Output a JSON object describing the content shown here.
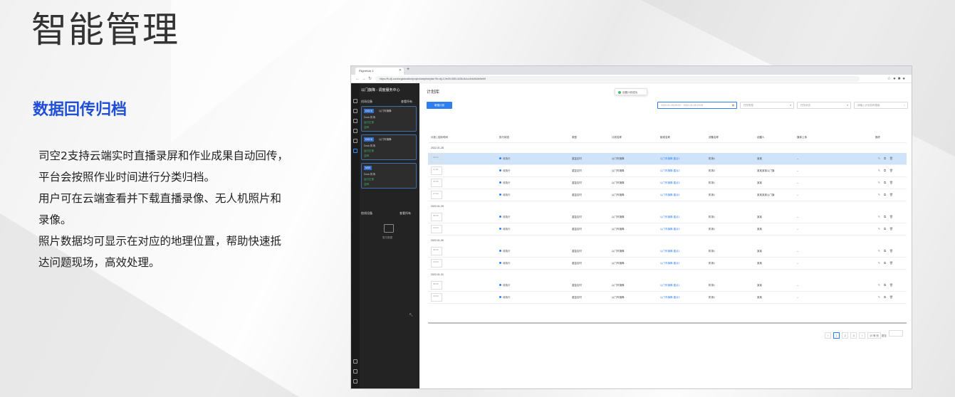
{
  "slide": {
    "title": "智能管理",
    "section_title": "数据回传归档",
    "paragraphs": [
      "司空2支持云端实时直播录屏和作业成果自动回传，",
      "平台会按照作业时间进行分类归档。",
      "用户可在云端查看并下载直播录像、无人机照片和",
      "录像。",
      "照片数据均可显示在对应的地理位置，帮助快速抵",
      "达问题现场，高效处理。"
    ]
  },
  "browser": {
    "tab_label": "FlightHub 2",
    "url": "https://fh.dji.com/organization/project/wayline/plan?fh=dji-2-9e09-f083-4436-8c1a-fb4d9d3e5e59",
    "app": {
      "sidebar": {
        "title": "以门旗降 - 调度服务中心",
        "section1": "机场设备",
        "section1_action": "查看所有",
        "cards": [
          {
            "tag": "DOCK",
            "name": "以门市旗降",
            "line1": "Dock 机场",
            "line2": "运行正常",
            "line3": "空闲"
          },
          {
            "tag": "DOCK",
            "name": "以门市旗降",
            "line1": "Dock 机场",
            "line2": "运行正常",
            "line3": "空闲"
          },
          {
            "tag": "M30",
            "name": "",
            "line1": "Dock 机场",
            "line2": "运行正常",
            "line3": "空闲"
          }
        ],
        "section2": "航线设备",
        "section2_action": "查看所有",
        "empty_text": "暂无数据"
      },
      "content": {
        "page_title": "计划库",
        "toast": "创建计划成功",
        "new_button": "新建计划",
        "date_range": "2022-01-28 00:00  ~  2022-01-28 23:59",
        "filter_type": "任务类型",
        "filter_status": "任务状态",
        "search_placeholder": "请输入计划名称搜索",
        "columns": [
          "计划 | 实际时间",
          "执行状态",
          "类型",
          "计划名称",
          "航线名称",
          "设备名称",
          "创建人",
          "媒体上传",
          "操作"
        ],
        "groups": [
          {
            "date": "2022-01-28",
            "rows": [
              {
                "time": "09:04",
                "status": "待执行",
                "type": "重复定时",
                "plan": "以门市旗降",
                "route": "以门市旗降 建点1",
                "device": "机场1",
                "creator": "某某",
                "media": "--",
                "selected": true
              },
              {
                "time": "11:00",
                "status": "待执行",
                "type": "重复定时",
                "plan": "以门市旗降",
                "route": "以门市旗降 建点2",
                "device": "机场2",
                "creator": "某某某某以门旗",
                "media": "--",
                "selected": false
              },
              {
                "time": "15:00",
                "status": "待执行",
                "type": "重复定时",
                "plan": "以门市旗降",
                "route": "以门市旗降 建点3",
                "device": "机场1",
                "creator": "某某",
                "media": "--",
                "selected": false
              },
              {
                "time": "17:00",
                "status": "待执行",
                "type": "重复定时",
                "plan": "以门市旗降",
                "route": "以门市旗降 建点4",
                "device": "机场1",
                "creator": "某某某某以门旗",
                "media": "--",
                "selected": false
              }
            ]
          },
          {
            "date": "2022-01-29",
            "rows": [
              {
                "time": "09:00",
                "status": "待执行",
                "type": "重复定时",
                "plan": "以门市旗降",
                "route": "以门市旗降 建点1",
                "device": "机场1",
                "creator": "某某",
                "media": "--",
                "selected": false
              },
              {
                "time": "13:00",
                "status": "待执行",
                "type": "重复定时",
                "plan": "以门市旗降",
                "route": "以门市旗降 建点3",
                "device": "机场1",
                "creator": "某某",
                "media": "--",
                "selected": false
              }
            ]
          },
          {
            "date": "2022-01-30",
            "rows": [
              {
                "time": "09:00",
                "status": "待执行",
                "type": "重复定时",
                "plan": "以门市旗降",
                "route": "以门市旗降 建点1",
                "device": "机场1",
                "creator": "某某",
                "media": "--",
                "selected": false
              },
              {
                "time": "16:00",
                "status": "待执行",
                "type": "重复定时",
                "plan": "以门市旗降",
                "route": "以门市旗降 建点2",
                "device": "机场1",
                "creator": "某某",
                "media": "--",
                "selected": false
              }
            ]
          },
          {
            "date": "2022-01-31",
            "rows": [
              {
                "time": "09:00",
                "status": "待执行",
                "type": "重复定时",
                "plan": "以门市旗降",
                "route": "以门市旗降 建点1",
                "device": "机场1",
                "creator": "某某",
                "media": "--",
                "selected": false
              },
              {
                "time": "14:00",
                "status": "待执行",
                "type": "重复定时",
                "plan": "以门市旗降",
                "route": "以门市旗降 建点3",
                "device": "机场1",
                "creator": "某某",
                "media": "--",
                "selected": false
              }
            ]
          }
        ],
        "pager": {
          "prev": "‹",
          "pages": [
            "1",
            "2",
            "3"
          ],
          "next": "›",
          "size": "10 条/页",
          "goto": "跳至"
        }
      }
    }
  },
  "colors": {
    "accent": "#1e4fd6",
    "app_primary": "#2f7ef0",
    "sidebar_bg": "#232323"
  }
}
